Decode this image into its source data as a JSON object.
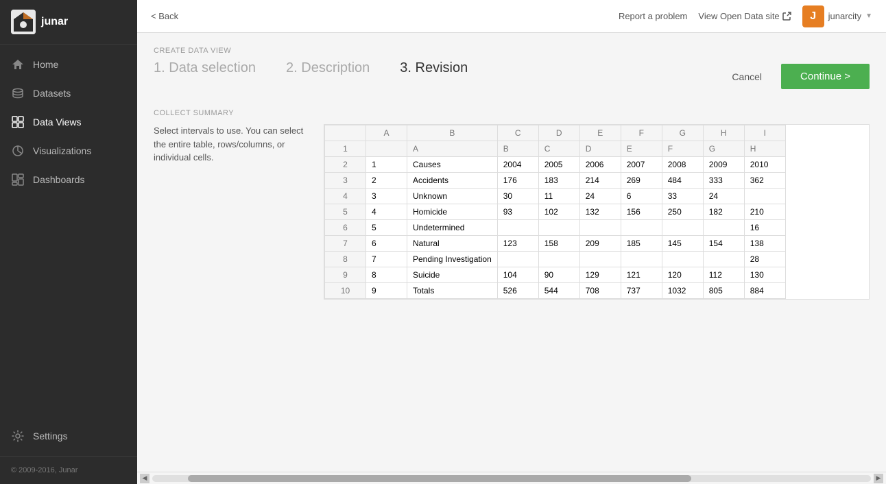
{
  "app": {
    "logo_text": "junar",
    "copyright": "© 2009-2016, Junar"
  },
  "sidebar": {
    "items": [
      {
        "id": "home",
        "label": "Home",
        "icon": "home-icon"
      },
      {
        "id": "datasets",
        "label": "Datasets",
        "icon": "datasets-icon"
      },
      {
        "id": "dataviews",
        "label": "Data Views",
        "icon": "dataviews-icon",
        "active": true
      },
      {
        "id": "visualizations",
        "label": "Visualizations",
        "icon": "visualizations-icon"
      },
      {
        "id": "dashboards",
        "label": "Dashboards",
        "icon": "dashboards-icon"
      }
    ],
    "footer_item": {
      "id": "settings",
      "label": "Settings",
      "icon": "settings-icon"
    }
  },
  "topbar": {
    "back_label": "< Back",
    "report_label": "Report a problem",
    "open_data_label": "View Open Data site",
    "user_avatar_char": "J",
    "username": "junarcity",
    "dropdown_icon": "▼"
  },
  "wizard": {
    "page_label": "CREATE DATA VIEW",
    "steps": [
      {
        "number": "1.",
        "label": "Data selection",
        "active": false
      },
      {
        "number": "2.",
        "label": "Description",
        "active": false
      },
      {
        "number": "3.",
        "label": "Revision",
        "active": true
      }
    ],
    "cancel_label": "Cancel",
    "continue_label": "Continue >"
  },
  "collect_summary": {
    "section_label": "COLLECT SUMMARY",
    "description": "Select intervals to use. You can select the entire table, rows/columns, or individual cells."
  },
  "table": {
    "col_headers": [
      "",
      "A",
      "B",
      "C",
      "D",
      "E",
      "F",
      "G",
      "H",
      "I"
    ],
    "rows": [
      {
        "row_num": 1,
        "cells": [
          "",
          "A",
          "B",
          "C",
          "D",
          "E",
          "F",
          "G",
          "H"
        ]
      },
      {
        "row_num": 2,
        "cells": [
          "1",
          "Causes",
          "2004",
          "2005",
          "2006",
          "2007",
          "2008",
          "2009",
          "2010"
        ]
      },
      {
        "row_num": 3,
        "cells": [
          "2",
          "Accidents",
          "176",
          "183",
          "214",
          "269",
          "484",
          "333",
          "362"
        ]
      },
      {
        "row_num": 4,
        "cells": [
          "3",
          "Unknown",
          "30",
          "11",
          "24",
          "6",
          "33",
          "24",
          ""
        ]
      },
      {
        "row_num": 5,
        "cells": [
          "4",
          "Homicide",
          "93",
          "102",
          "132",
          "156",
          "250",
          "182",
          "210"
        ]
      },
      {
        "row_num": 6,
        "cells": [
          "5",
          "Undetermined",
          "",
          "",
          "",
          "",
          "",
          "",
          "16"
        ]
      },
      {
        "row_num": 7,
        "cells": [
          "6",
          "Natural",
          "123",
          "158",
          "209",
          "185",
          "145",
          "154",
          "138"
        ]
      },
      {
        "row_num": 8,
        "cells": [
          "7",
          "Pending Investigation",
          "",
          "",
          "",
          "",
          "",
          "",
          "28"
        ]
      },
      {
        "row_num": 9,
        "cells": [
          "8",
          "Suicide",
          "104",
          "90",
          "129",
          "121",
          "120",
          "112",
          "130"
        ]
      },
      {
        "row_num": 10,
        "cells": [
          "9",
          "Totals",
          "526",
          "544",
          "708",
          "737",
          "1032",
          "805",
          "884"
        ]
      }
    ]
  }
}
